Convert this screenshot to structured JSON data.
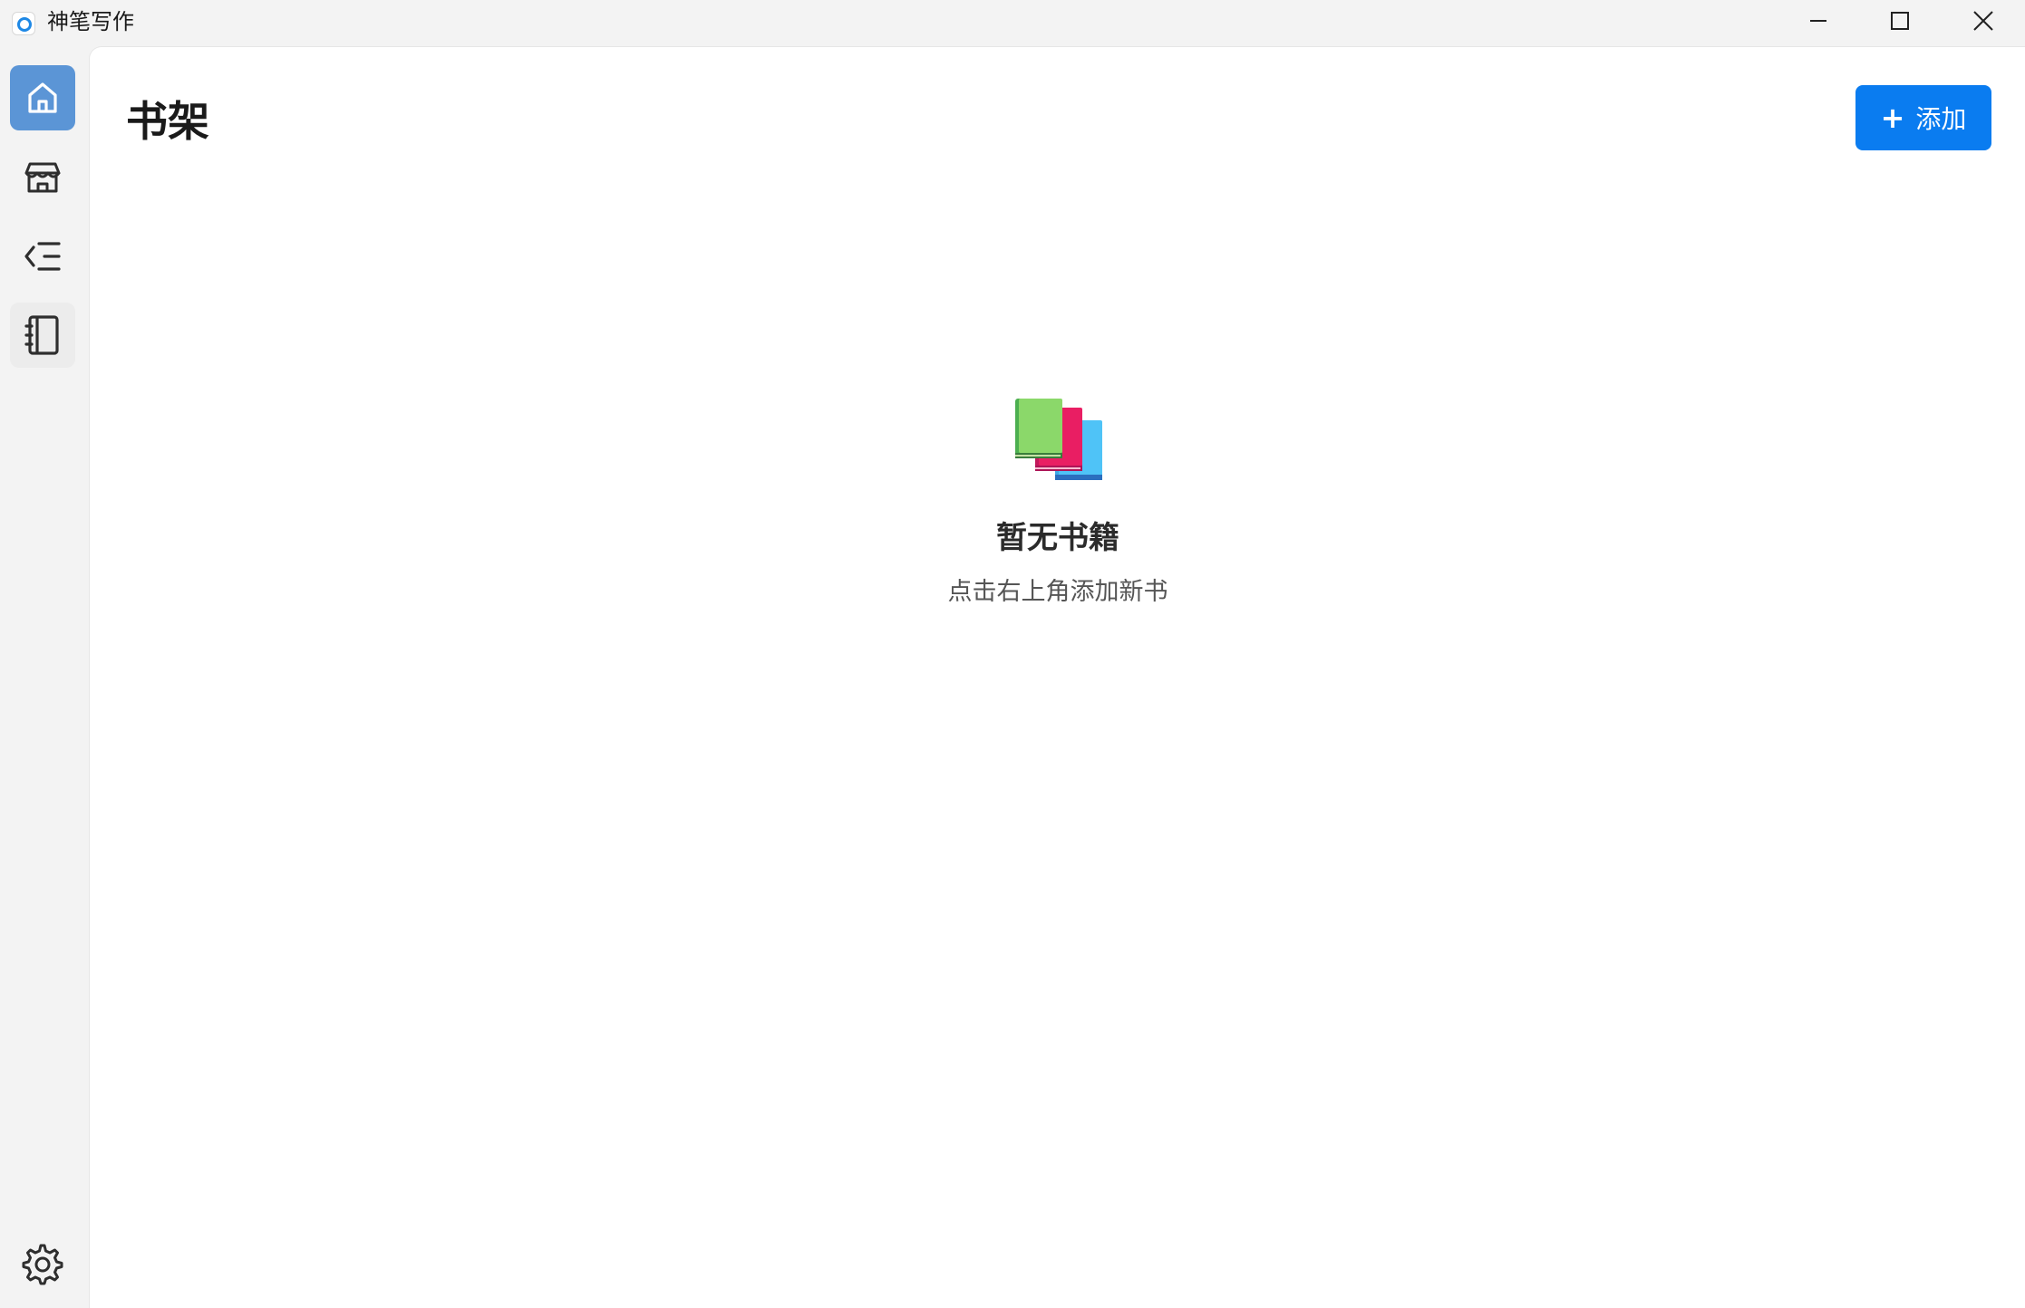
{
  "window": {
    "title": "神笔写作",
    "controls": {
      "minimize_icon": "minimize-icon",
      "maximize_icon": "maximize-icon",
      "close_icon": "close-icon"
    }
  },
  "sidebar": {
    "items": [
      {
        "icon": "home-icon",
        "active": true
      },
      {
        "icon": "store-icon",
        "active": false
      },
      {
        "icon": "outline-list-icon",
        "active": false
      },
      {
        "icon": "notebook-icon",
        "active": false
      }
    ],
    "bottom": {
      "icon": "settings-gear-icon"
    }
  },
  "header": {
    "title": "书架",
    "add_button": {
      "icon": "+",
      "label": "添加"
    }
  },
  "empty_state": {
    "illustration": "books-stack-icon",
    "title": "暂无书籍",
    "subtitle": "点击右上角添加新书"
  },
  "colors": {
    "accent": "#0a7cf0",
    "active_nav": "#5b95d6",
    "sidebar_bg": "#f3f3f3",
    "content_bg": "#ffffff"
  }
}
